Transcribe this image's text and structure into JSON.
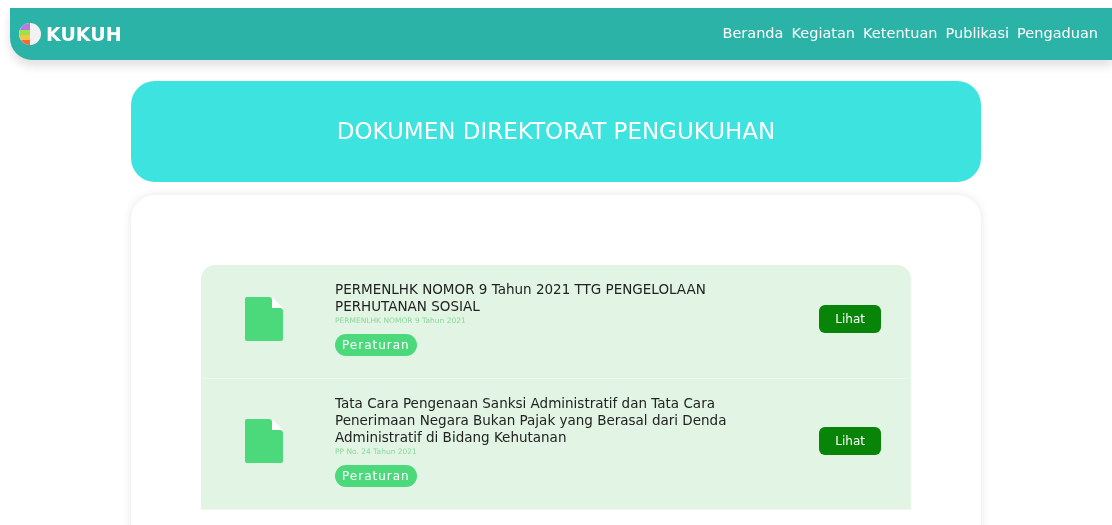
{
  "navbar": {
    "brand": "KUKUH",
    "links": [
      "Beranda",
      "Kegiatan",
      "Ketentuan",
      "Publikasi",
      "Pengaduan"
    ]
  },
  "heading": "DOKUMEN DIREKTORAT PENGUKUHAN",
  "documents": [
    {
      "title": "PERMENLHK NOMOR 9 Tahun 2021 TTG PENGELOLAAN PERHUTANAN SOSIAL",
      "subtitle": "PERMENLHK NOMOR 9 Tahun 2021",
      "tag": "Peraturan",
      "button": "Lihat"
    },
    {
      "title": "Tata Cara Pengenaan Sanksi Administratif dan Tata Cara Penerimaan Negara Bukan Pajak yang Berasal dari Denda Administratif di Bidang Kehutanan",
      "subtitle": "PP No. 24 Tahun 2021",
      "tag": "Peraturan",
      "button": "Lihat"
    }
  ]
}
